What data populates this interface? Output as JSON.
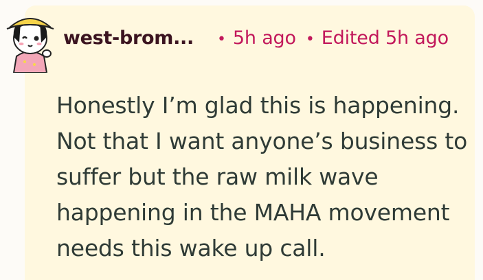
{
  "comment": {
    "author": "west-brom...",
    "timestamp": "5h ago",
    "edited": "Edited 5h ago",
    "separator": "•",
    "body": "Honestly I’m glad this is happening. Not that I want anyone’s business to suffer but the raw milk wave happening in the MAHA movement needs this wake up call."
  },
  "colors": {
    "card_background": "#fff8df",
    "author": "#3b1420",
    "meta": "#c2185b",
    "body": "#2f3b36"
  },
  "icons": {
    "avatar": "avatar-icon"
  }
}
